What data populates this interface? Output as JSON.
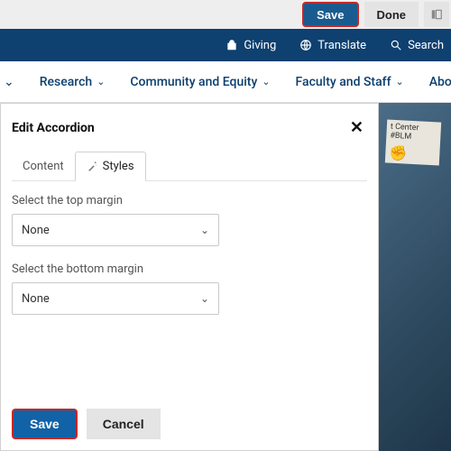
{
  "topbar": {
    "save_label": "Save",
    "done_label": "Done"
  },
  "utility": {
    "giving": "Giving",
    "translate": "Translate",
    "search": "Search"
  },
  "nav": {
    "items": [
      {
        "label": "Research"
      },
      {
        "label": "Community and Equity"
      },
      {
        "label": "Faculty and Staff"
      },
      {
        "label": "About"
      }
    ]
  },
  "hero": {
    "sign_line1": "t Center",
    "sign_line2": "#BLM"
  },
  "modal": {
    "title": "Edit Accordion",
    "tabs": {
      "content_label": "Content",
      "styles_label": "Styles"
    },
    "top_margin_label": "Select the top margin",
    "top_margin_value": "None",
    "bottom_margin_label": "Select the bottom margin",
    "bottom_margin_value": "None",
    "save_label": "Save",
    "cancel_label": "Cancel"
  }
}
